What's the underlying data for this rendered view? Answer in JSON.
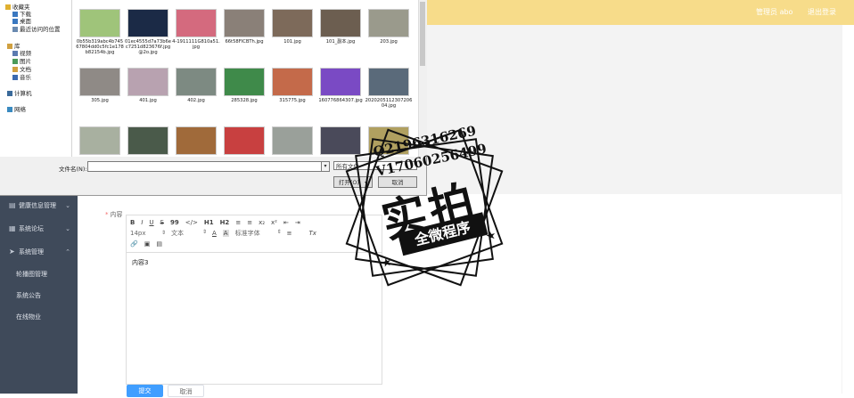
{
  "topbar": {
    "admin_link": "管理员 abo",
    "logout_link": "退出登录"
  },
  "sidebar": {
    "items": [
      {
        "label": "健康信息管理"
      },
      {
        "label": "系统论坛"
      },
      {
        "label": "系统管理"
      }
    ],
    "subitems": [
      {
        "label": "轮播图管理"
      },
      {
        "label": "系统公告"
      },
      {
        "label": "在线物业"
      }
    ]
  },
  "form": {
    "required_mark": "*",
    "content_label": "内容",
    "editor_text": "内容3",
    "submit_label": "提交",
    "cancel_label": "取消"
  },
  "editor_toolbar": {
    "row1": [
      "B",
      "I",
      "U",
      "S",
      "99",
      "</>",
      "H1",
      "H2",
      "≡",
      "≡",
      "x₂",
      "x²",
      "⇤",
      "⇥"
    ],
    "size_value": "14px",
    "text_type": "文本",
    "font_value": "标准字体",
    "row1b": [
      "A",
      "A"
    ],
    "align": "≡",
    "clear": "Tx"
  },
  "dialog": {
    "nav": [
      {
        "label": "收藏夹",
        "icon": "star-icon"
      },
      {
        "label": "下载",
        "icon": "download-icon"
      },
      {
        "label": "桌面",
        "icon": "desktop-icon"
      },
      {
        "label": "最近访问的位置",
        "icon": "recent-icon"
      },
      {
        "label": "库",
        "icon": "library-icon"
      },
      {
        "label": "视频",
        "icon": "video-icon"
      },
      {
        "label": "图片",
        "icon": "picture-icon"
      },
      {
        "label": "文档",
        "icon": "document-icon"
      },
      {
        "label": "音乐",
        "icon": "music-icon"
      },
      {
        "label": "计算机",
        "icon": "computer-icon"
      },
      {
        "label": "网络",
        "icon": "network-icon"
      }
    ],
    "files": [
      {
        "name": "0b55b319abc4b74567804dd0c5fc1e178b82154b.jpg",
        "color": "#9fc47a"
      },
      {
        "name": "01ec4555d7a73b6ec7251d823676f.jpg@2o.jpg",
        "color": "#1b2a46"
      },
      {
        "name": "4-1911111G810a51.jpg",
        "color": "#d46a7e"
      },
      {
        "name": "66t58FICBTh.jpg",
        "color": "#8a8078"
      },
      {
        "name": "101.jpg",
        "color": "#7d6a5a"
      },
      {
        "name": "101_副本.jpg",
        "color": "#6c5e50"
      },
      {
        "name": "203.jpg",
        "color": "#9a9a8c"
      },
      {
        "name": "305.jpg",
        "color": "#8f8a86"
      },
      {
        "name": "401.jpg",
        "color": "#b8a2b0"
      },
      {
        "name": "402.jpg",
        "color": "#7d8a82"
      },
      {
        "name": "285328.jpg",
        "color": "#3f8a4a"
      },
      {
        "name": "315775.jpg",
        "color": "#c46a4a"
      },
      {
        "name": "160776864307.jpg",
        "color": "#7a4ac4"
      },
      {
        "name": "202020511230720604.jpg",
        "color": "#5a6a7a"
      },
      {
        "name": "",
        "color": "#a8b0a0"
      },
      {
        "name": "",
        "color": "#4a5a4a"
      },
      {
        "name": "",
        "color": "#a06a3a"
      },
      {
        "name": "",
        "color": "#c84040"
      },
      {
        "name": "",
        "color": "#9aa09a"
      },
      {
        "name": "",
        "color": "#4a4a5a"
      },
      {
        "name": "",
        "color": "#b0a060"
      }
    ],
    "filename_label": "文件名(N):",
    "filetype_value": "所有文件",
    "open_label": "打开(O)",
    "cancel_label": "取消"
  },
  "watermark": {
    "qq": "Q2196316269",
    "vx": "V17060256499",
    "big": "实拍",
    "banner": "全微程序"
  }
}
